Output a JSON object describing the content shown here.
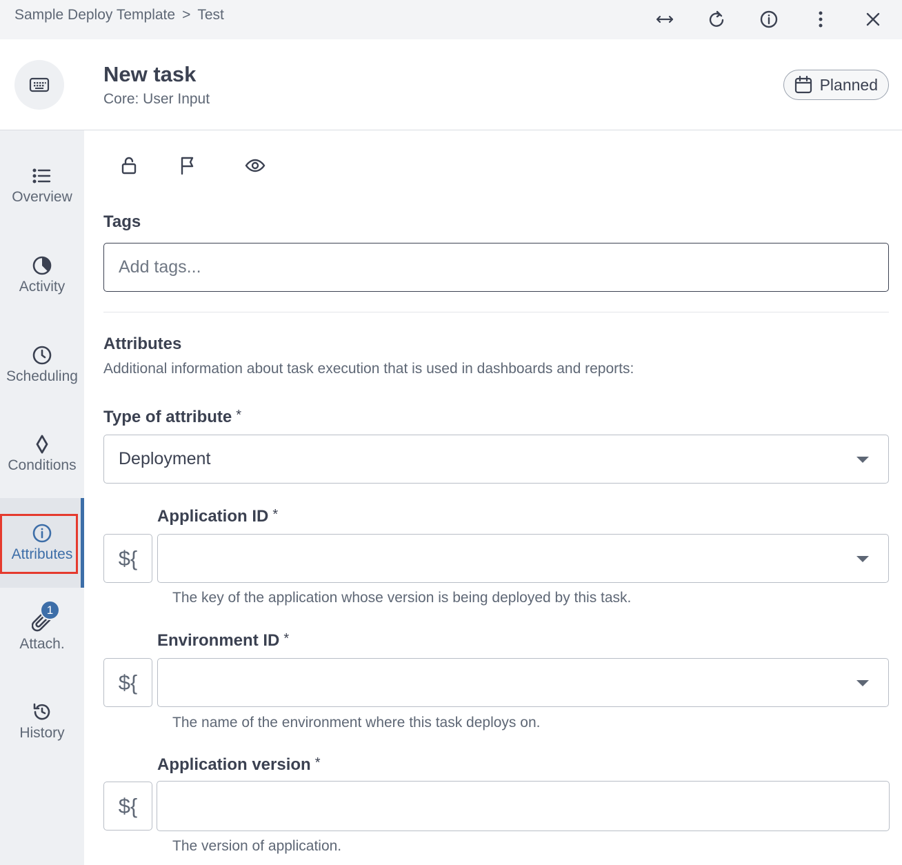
{
  "breadcrumb": {
    "parent": "Sample Deploy Template",
    "separator": ">",
    "current": "Test"
  },
  "header": {
    "title": "New task",
    "subtitle": "Core: User Input",
    "status": "Planned"
  },
  "sidebar": {
    "items": [
      {
        "label": "Overview",
        "icon": "list-icon"
      },
      {
        "label": "Activity",
        "icon": "activity-pie-icon"
      },
      {
        "label": "Scheduling",
        "icon": "clock-icon"
      },
      {
        "label": "Conditions",
        "icon": "diamond-icon"
      },
      {
        "label": "Attributes",
        "icon": "info-icon",
        "active": true
      },
      {
        "label": "Attach.",
        "icon": "paperclip-icon",
        "badge": "1"
      },
      {
        "label": "History",
        "icon": "history-icon"
      }
    ]
  },
  "tags": {
    "label": "Tags",
    "placeholder": "Add tags..."
  },
  "attributes": {
    "heading": "Attributes",
    "description": "Additional information about task execution that is used in dashboards and reports:",
    "type_label": "Type of attribute",
    "type_value": "Deployment",
    "variable_button": "${",
    "required_mark": "*",
    "fields": [
      {
        "label": "Application ID",
        "help": "The key of the application whose version is being deployed by this task.",
        "value": ""
      },
      {
        "label": "Environment ID",
        "help": "The name of the environment where this task deploys on.",
        "value": ""
      },
      {
        "label": "Application version",
        "help": "The version of application.",
        "value": ""
      }
    ]
  },
  "colors": {
    "accent": "#3d6ea8",
    "highlight": "#e53a2e",
    "sidebar_bg": "#eef0f3",
    "topbar_bg": "#f3f4f6"
  }
}
